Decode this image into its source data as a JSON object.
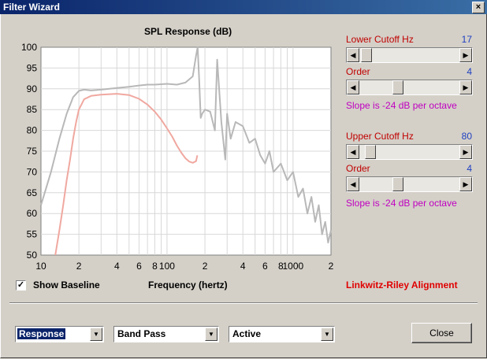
{
  "window": {
    "title": "Filter Wizard",
    "close_glyph": "×"
  },
  "chart_data": {
    "type": "line",
    "title": "SPL Response (dB)",
    "xlabel": "Frequency (hertz)",
    "ylabel": "",
    "x_scale": "log",
    "xlim": [
      10,
      2000
    ],
    "ylim": [
      50,
      100
    ],
    "y_ticks": [
      "100",
      "95",
      "90",
      "85",
      "80",
      "75",
      "70",
      "65",
      "60",
      "55",
      "50"
    ],
    "x_tick_labels": [
      {
        "x": 10,
        "label": "10"
      },
      {
        "x": 20,
        "label": "2"
      },
      {
        "x": 40,
        "label": "4"
      },
      {
        "x": 60,
        "label": "6"
      },
      {
        "x": 80,
        "label": "8"
      },
      {
        "x": 100,
        "label": "100"
      },
      {
        "x": 200,
        "label": "2"
      },
      {
        "x": 400,
        "label": "4"
      },
      {
        "x": 600,
        "label": "6"
      },
      {
        "x": 800,
        "label": "8"
      },
      {
        "x": 1000,
        "label": "1000"
      },
      {
        "x": 2000,
        "label": "2"
      }
    ],
    "grid": true,
    "colors": {
      "baseline": "#b8b8b8",
      "filtered": "#f0a8a0"
    },
    "series": [
      {
        "key": "baseline",
        "x": [
          10,
          12,
          14,
          16,
          18,
          20,
          22,
          25,
          30,
          40,
          50,
          60,
          70,
          80,
          100,
          120,
          140,
          160,
          170,
          175,
          180,
          185,
          190,
          200,
          220,
          240,
          250,
          270,
          290,
          300,
          320,
          350,
          400,
          450,
          500,
          550,
          600,
          650,
          700,
          800,
          900,
          1000,
          1100,
          1200,
          1300,
          1400,
          1500,
          1600,
          1700,
          1800,
          1900,
          2000
        ],
        "y": [
          62,
          70,
          78,
          84,
          88,
          89.5,
          89.8,
          89.6,
          89.8,
          90.2,
          90.5,
          90.8,
          91,
          91,
          91.2,
          91,
          91.5,
          93,
          98,
          100,
          92,
          83,
          84,
          85,
          84.5,
          80,
          97,
          82,
          73,
          84,
          78,
          82,
          81,
          77,
          78,
          74,
          72,
          75,
          70,
          72,
          68,
          70,
          64,
          66,
          60,
          64,
          58,
          62,
          55,
          58,
          53,
          56
        ]
      },
      {
        "key": "filtered",
        "x": [
          13,
          14,
          15,
          16,
          17,
          18,
          19,
          20,
          22,
          25,
          30,
          40,
          50,
          60,
          70,
          80,
          90,
          100,
          110,
          120,
          130,
          140,
          150,
          160,
          170,
          174
        ],
        "y": [
          50,
          56,
          62,
          68,
          73,
          78,
          82,
          85,
          87.5,
          88.3,
          88.6,
          88.8,
          88.5,
          87.6,
          86.2,
          84.5,
          82.6,
          80.5,
          78.5,
          76.3,
          74.6,
          73.3,
          72.5,
          72.2,
          72.6,
          74
        ]
      }
    ]
  },
  "controls": {
    "lower_cutoff_label": "Lower Cutoff  Hz",
    "lower_cutoff_value": "17",
    "lower_cutoff_fraction": 0.02,
    "lower_order_label": "Order",
    "lower_order_value": "4",
    "lower_order_fraction": 0.38,
    "lower_slope_text": "Slope is -24 dB per octave",
    "upper_cutoff_label": "Upper Cutoff  Hz",
    "upper_cutoff_value": "80",
    "upper_cutoff_fraction": 0.06,
    "upper_order_label": "Order",
    "upper_order_value": "4",
    "upper_order_fraction": 0.38,
    "upper_slope_text": "Slope is -24 dB per octave",
    "alignment_text": "Linkwitz-Riley Alignment",
    "show_baseline_label": "Show Baseline",
    "show_baseline_checked": true,
    "check_glyph": "✓",
    "arrow_left": "◀",
    "arrow_right": "▶",
    "arrow_down": "▼"
  },
  "bottom": {
    "view_select": "Response",
    "filter_type_select": "Band Pass",
    "mode_select": "Active",
    "close_label": "Close"
  }
}
